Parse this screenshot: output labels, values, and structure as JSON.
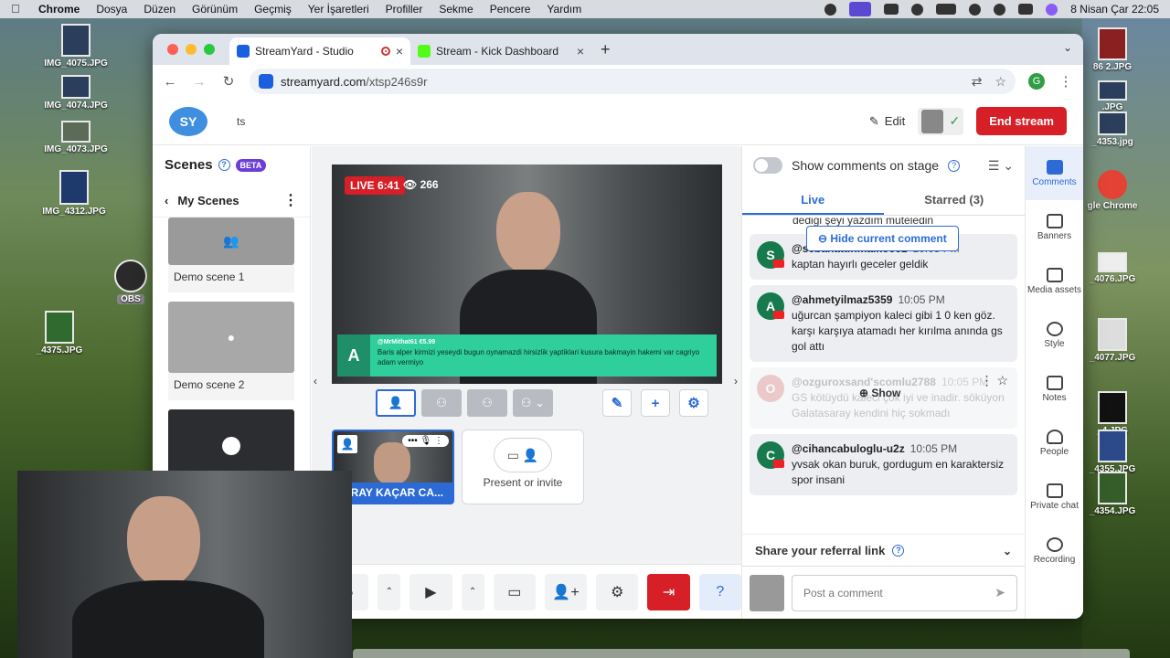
{
  "menubar": {
    "app": "Chrome",
    "items": [
      "Dosya",
      "Düzen",
      "Görünüm",
      "Geçmiş",
      "Yer İşaretleri",
      "Profiller",
      "Sekme",
      "Pencere",
      "Yardım"
    ],
    "clock": "8 Nisan Çar  22:05"
  },
  "desktop": {
    "icons_left": [
      "IMG_4075.JPG",
      "IMG_4074.JPG",
      "IMG_4073.JPG",
      "IMG_4312.JPG",
      "OBS",
      "_4375.JPG"
    ],
    "icons_right": [
      "86 2.JPG",
      ".JPG",
      "_4353.jpg",
      "gle Chrome",
      "_4076.JPG",
      "_4077.JPG",
      "_4.JPG",
      "_4355.JPG",
      "_4354.JPG"
    ]
  },
  "browser": {
    "tabs": [
      {
        "title": "StreamYard - Studio",
        "active": true
      },
      {
        "title": "Stream - Kick Dashboard",
        "active": false
      }
    ],
    "url_host": "streamyard.com",
    "url_path": "/xtsp246s9r",
    "profile_letter": "G"
  },
  "header": {
    "logo_text": "SY",
    "broadcast_title": "ts",
    "edit_label": "Edit",
    "end_label": "End stream"
  },
  "scenes": {
    "title": "Scenes",
    "beta": "BETA",
    "group": "My Scenes",
    "items": [
      {
        "name": "Demo scene 1"
      },
      {
        "name": "Demo scene 2"
      },
      {
        "name": ""
      }
    ]
  },
  "stage": {
    "live": "LIVE 6:41",
    "viewers": "266",
    "banner_user": "@MrMithat61  €5.99",
    "banner_text": "Baris alper kirmizi yeseydi bugun oynamazdi hirsizlik yaptiklari kusura bakmayin hakemi var cagriyo adam vermiyo",
    "banner_avatar": "A",
    "participant_name": "GİRAY KAÇAR CA...",
    "invite_label": "Present or invite"
  },
  "chat": {
    "show_on_stage": "Show comments on stage",
    "tab_live": "Live",
    "tab_starred": "Starred (3)",
    "cut_text": "dediği şeyi yazdım muteledin",
    "hide_current": "Hide current comment",
    "comments": [
      {
        "avatar": "S",
        "user": "@sebahattinmalkoc61",
        "time": "10:05 PM",
        "text": "kaptan hayırlı geceler geldik",
        "hidden": false
      },
      {
        "avatar": "A",
        "user": "@ahmetyilmaz5359",
        "time": "10:05 PM",
        "text": "uğurcan şampiyon kaleci gibi 1 0 ken göz. karşı karşıya atamadı her kırılma anında gs gol attı",
        "hidden": false
      },
      {
        "avatar": "O",
        "user": "@ozguroxsand'scomlu2788",
        "time": "10:05 PM",
        "text": "GS kötüydü kaleci çok iyi ve inadir. söküyon Galatasaray kendini hiç sokmadı",
        "hidden": true,
        "show_label": "Show"
      },
      {
        "avatar": "C",
        "user": "@cihancabuloglu-u2z",
        "time": "10:05 PM",
        "text": "yvsak okan buruk, gordugum en karaktersiz spor insani",
        "hidden": false
      }
    ],
    "referral": "Share your referral link",
    "composer_placeholder": "Post a comment"
  },
  "rail": [
    {
      "label": "Comments",
      "icon": "comments-icon",
      "active": true
    },
    {
      "label": "Banners",
      "icon": "banners-icon",
      "active": false
    },
    {
      "label": "Media assets",
      "icon": "media-icon",
      "active": false
    },
    {
      "label": "Style",
      "icon": "style-icon",
      "active": false
    },
    {
      "label": "Notes",
      "icon": "notes-icon",
      "active": false
    },
    {
      "label": "People",
      "icon": "people-icon",
      "active": false
    },
    {
      "label": "Private chat",
      "icon": "private-chat-icon",
      "active": false
    },
    {
      "label": "Recording",
      "icon": "recording-icon",
      "active": false
    }
  ]
}
